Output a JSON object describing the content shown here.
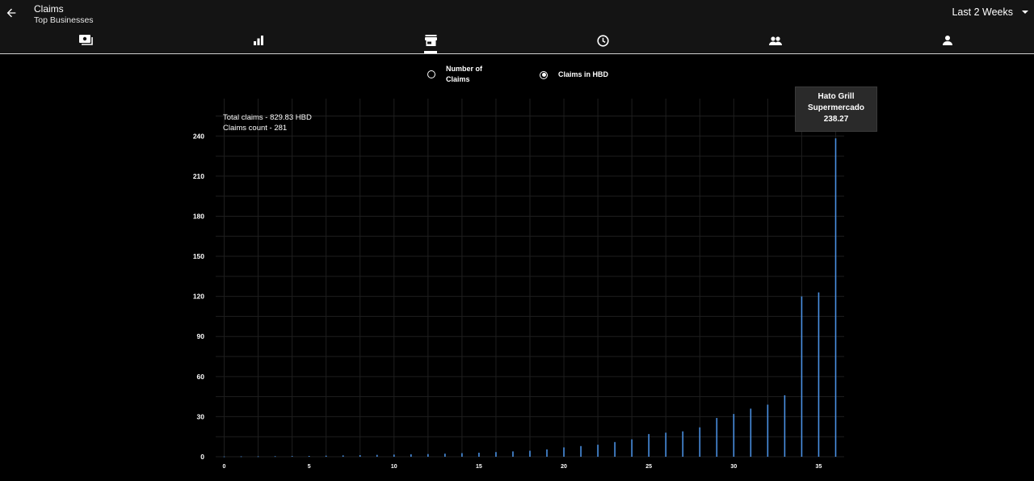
{
  "header": {
    "title": "Claims",
    "subtitle": "Top Businesses",
    "range_label": "Last 2 Weeks"
  },
  "tabs": [
    {
      "icon": "payments-icon",
      "active": false
    },
    {
      "icon": "bar-chart-icon",
      "active": false
    },
    {
      "icon": "store-icon",
      "active": true
    },
    {
      "icon": "clock-icon",
      "active": false
    },
    {
      "icon": "group-icon",
      "active": false
    },
    {
      "icon": "person-icon",
      "active": false
    }
  ],
  "toggle": {
    "option_count": "Number of Claims",
    "option_hbd": "Claims in HBD",
    "selected": "hbd"
  },
  "summary": {
    "total": "Total claims - 829.83 HBD",
    "count": "Claims count - 281"
  },
  "tooltip": {
    "name": "Hato Grill Supermercado",
    "value": "238.27"
  },
  "colors": {
    "bar": "#4a90e2",
    "background": "#000000",
    "header": "#141414"
  },
  "chart_data": {
    "type": "bar",
    "x": [
      0,
      1,
      2,
      3,
      4,
      5,
      6,
      7,
      8,
      9,
      10,
      11,
      12,
      13,
      14,
      15,
      16,
      17,
      18,
      19,
      20,
      21,
      22,
      23,
      24,
      25,
      26,
      27,
      28,
      29,
      30,
      31,
      32,
      33,
      34,
      35,
      36
    ],
    "values": [
      0.2,
      0.3,
      0.3,
      0.4,
      0.5,
      0.6,
      0.8,
      1,
      1.2,
      1.4,
      1.6,
      1.8,
      2,
      2.3,
      2.7,
      3,
      3.5,
      4,
      4.5,
      5.5,
      7,
      8,
      9,
      11,
      13,
      17,
      18,
      19,
      22,
      29,
      32,
      36,
      39,
      46,
      120,
      123,
      238.27
    ],
    "yticks": [
      0,
      30,
      60,
      90,
      120,
      150,
      180,
      210,
      240
    ],
    "xticks": [
      0,
      5,
      10,
      15,
      20,
      25,
      30,
      35
    ],
    "ylim": [
      0,
      268
    ],
    "xlim": [
      -0.5,
      36.5
    ],
    "grid": true
  }
}
